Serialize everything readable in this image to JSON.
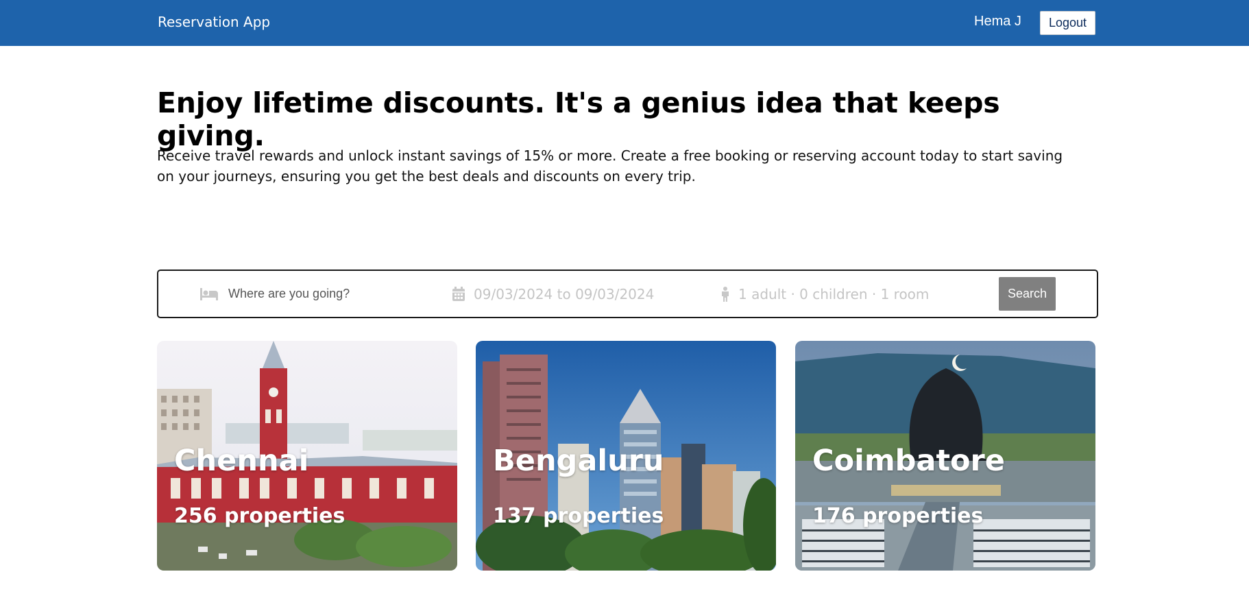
{
  "navbar": {
    "brand": "Reservation App",
    "user_name": "Hema J",
    "logout_label": "Logout",
    "background": "#1e63ab"
  },
  "hero": {
    "title": "Enjoy lifetime discounts. It's a genius idea that keeps giving.",
    "description": "Receive travel rewards and unlock instant savings of 15% or more. Create a free booking or reserving account today to start saving on your journeys, ensuring you get the best deals and discounts on every trip."
  },
  "search": {
    "destination_placeholder": "Where are you going?",
    "destination_icon": "bed-icon",
    "dates": "09/03/2024 to 09/03/2024",
    "dates_icon": "calendar-icon",
    "guests": "1 adult · 0 children · 1 room",
    "guests_icon": "person-icon",
    "search_label": "Search",
    "search_button_color": "#808080"
  },
  "cities": [
    {
      "name": "Chennai",
      "properties": "256 properties"
    },
    {
      "name": "Bengaluru",
      "properties": "137 properties"
    },
    {
      "name": "Coimbatore",
      "properties": "176 properties"
    }
  ]
}
